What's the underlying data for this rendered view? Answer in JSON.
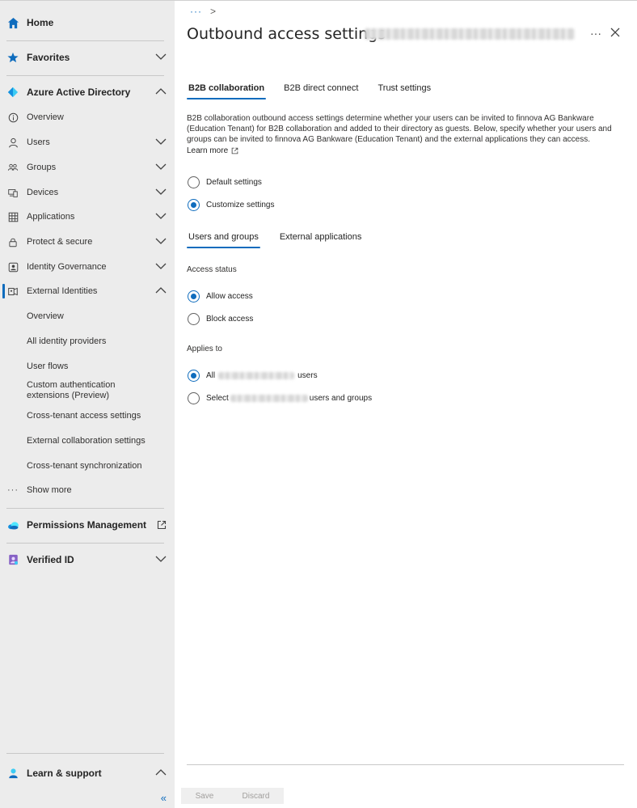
{
  "sidebar": {
    "home": "Home",
    "favorites": "Favorites",
    "aad": "Azure Active Directory",
    "items": [
      {
        "label": "Overview",
        "icon": "info-icon"
      },
      {
        "label": "Users",
        "icon": "user-icon"
      },
      {
        "label": "Groups",
        "icon": "groups-icon"
      },
      {
        "label": "Devices",
        "icon": "devices-icon"
      },
      {
        "label": "Applications",
        "icon": "applications-icon"
      },
      {
        "label": "Protect & secure",
        "icon": "lock-icon"
      },
      {
        "label": "Identity Governance",
        "icon": "identity-governance-icon"
      },
      {
        "label": "External Identities",
        "icon": "external-identities-icon"
      }
    ],
    "external_sub": [
      "Overview",
      "All identity providers",
      "User flows",
      "Custom authentication extensions (Preview)",
      "Cross-tenant access settings",
      "External collaboration settings",
      "Cross-tenant synchronization"
    ],
    "show_more": "Show more",
    "permissions": "Permissions Management",
    "verified": "Verified ID",
    "learn_support": "Learn & support",
    "collapse": "«"
  },
  "main": {
    "breadcrumb_dots": "···",
    "breadcrumb_sep": ">",
    "title": "Outbound access settings",
    "more": "···",
    "tabs": [
      "B2B collaboration",
      "B2B direct connect",
      "Trust settings"
    ],
    "description": "B2B collaboration outbound access settings determine whether your users can be invited to finnova AG Bankware (Education Tenant) for B2B collaboration and added to their directory as guests. Below, specify whether your users and groups can be invited to finnova AG Bankware (Education Tenant) and the external applications they can access.",
    "learn_more": "Learn more",
    "settings_options": [
      "Default settings",
      "Customize settings"
    ],
    "subtabs": [
      "Users and groups",
      "External applications"
    ],
    "access_status_label": "Access status",
    "access_options": [
      "Allow access",
      "Block access"
    ],
    "applies_to_label": "Applies to",
    "applies_all_prefix": "All",
    "applies_all_suffix": "users",
    "applies_select_prefix": "Select",
    "applies_select_suffix": "users and groups",
    "save": "Save",
    "discard": "Discard"
  },
  "colors": {
    "accent": "#0f6cbd",
    "sidebar_bg": "#ececec"
  }
}
